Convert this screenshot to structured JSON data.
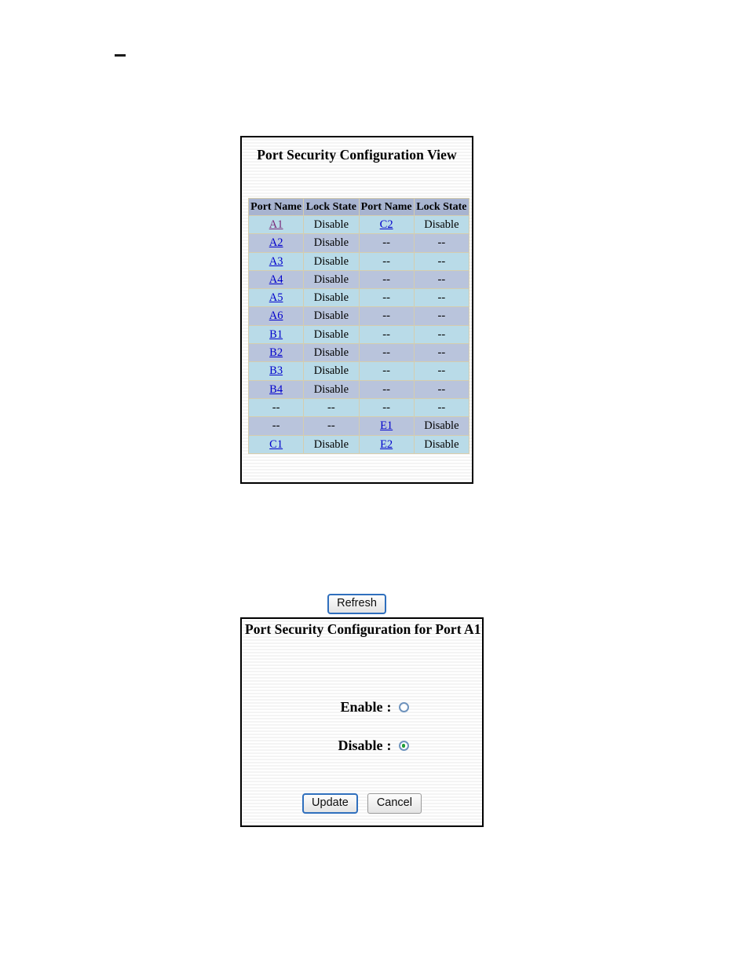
{
  "page": {
    "top_dash": "—"
  },
  "view_panel": {
    "title": "Port Security Configuration View",
    "columns": [
      "Port Name",
      "Lock State",
      "Port Name",
      "Lock State"
    ],
    "rows": [
      {
        "c0": "A1",
        "c0_link": true,
        "c0_visited": true,
        "c1": "Disable",
        "c2": "C2",
        "c2_link": true,
        "c3": "Disable"
      },
      {
        "c0": "A2",
        "c0_link": true,
        "c0_visited": false,
        "c1": "Disable",
        "c2": "--",
        "c2_link": false,
        "c3": "--"
      },
      {
        "c0": "A3",
        "c0_link": true,
        "c0_visited": false,
        "c1": "Disable",
        "c2": "--",
        "c2_link": false,
        "c3": "--"
      },
      {
        "c0": "A4",
        "c0_link": true,
        "c0_visited": false,
        "c1": "Disable",
        "c2": "--",
        "c2_link": false,
        "c3": "--"
      },
      {
        "c0": "A5",
        "c0_link": true,
        "c0_visited": false,
        "c1": "Disable",
        "c2": "--",
        "c2_link": false,
        "c3": "--"
      },
      {
        "c0": "A6",
        "c0_link": true,
        "c0_visited": false,
        "c1": "Disable",
        "c2": "--",
        "c2_link": false,
        "c3": "--"
      },
      {
        "c0": "B1",
        "c0_link": true,
        "c0_visited": false,
        "c1": "Disable",
        "c2": "--",
        "c2_link": false,
        "c3": "--"
      },
      {
        "c0": "B2",
        "c0_link": true,
        "c0_visited": false,
        "c1": "Disable",
        "c2": "--",
        "c2_link": false,
        "c3": "--"
      },
      {
        "c0": "B3",
        "c0_link": true,
        "c0_visited": false,
        "c1": "Disable",
        "c2": "--",
        "c2_link": false,
        "c3": "--"
      },
      {
        "c0": "B4",
        "c0_link": true,
        "c0_visited": false,
        "c1": "Disable",
        "c2": "--",
        "c2_link": false,
        "c3": "--"
      },
      {
        "c0": "--",
        "c0_link": false,
        "c0_visited": false,
        "c1": "--",
        "c2": "--",
        "c2_link": false,
        "c3": "--"
      },
      {
        "c0": "--",
        "c0_link": false,
        "c0_visited": false,
        "c1": "--",
        "c2": "E1",
        "c2_link": true,
        "c3": "Disable"
      },
      {
        "c0": "C1",
        "c0_link": true,
        "c0_visited": false,
        "c1": "Disable",
        "c2": "E2",
        "c2_link": true,
        "c3": "Disable"
      }
    ],
    "refresh_label": "Refresh"
  },
  "config_panel": {
    "title": "Port Security Configuration for Port A1",
    "options": [
      {
        "label": "Enable",
        "colon": ":",
        "selected": false
      },
      {
        "label": "Disable",
        "colon": ":",
        "selected": true
      }
    ],
    "update_label": "Update",
    "cancel_label": "Cancel"
  },
  "colors": {
    "header_bg": "#a8b4d0",
    "row_even_bg": "#b9dbe8",
    "row_odd_bg": "#b9c4dc",
    "grid_line": "#d5cdae",
    "link": "#0000cc",
    "link_visited": "#7a2a7a",
    "radio_selected_dot": "#1f9c35",
    "focus_border": "#2f6fbd"
  }
}
